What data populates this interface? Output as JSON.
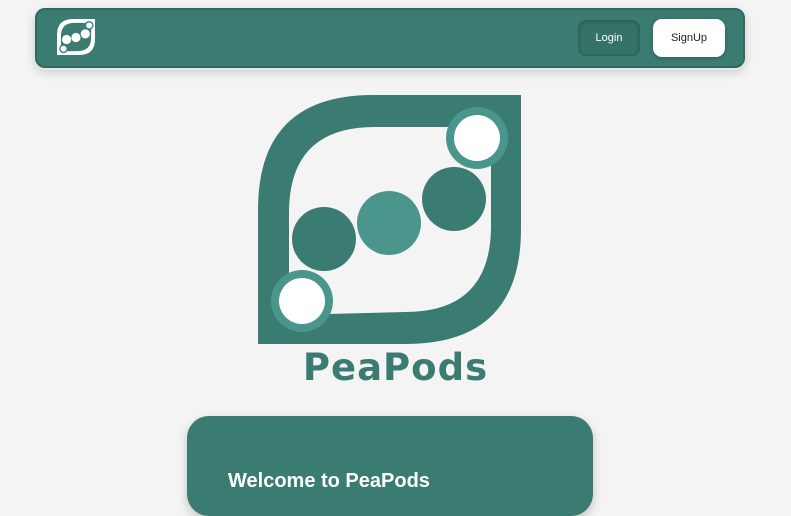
{
  "nav": {
    "login_label": "Login",
    "signup_label": "SignUp",
    "logo_icon": "peapod-logo-icon"
  },
  "hero": {
    "brand_name": "PeaPods",
    "logo_icon": "peapod-logo-icon"
  },
  "welcome": {
    "title": "Welcome to PeaPods"
  },
  "colors": {
    "primary": "#3a7c72",
    "primary_dark": "#357368",
    "pea_light": "#4a968d",
    "background": "#f4f4f4",
    "button_light": "#ffffff"
  }
}
